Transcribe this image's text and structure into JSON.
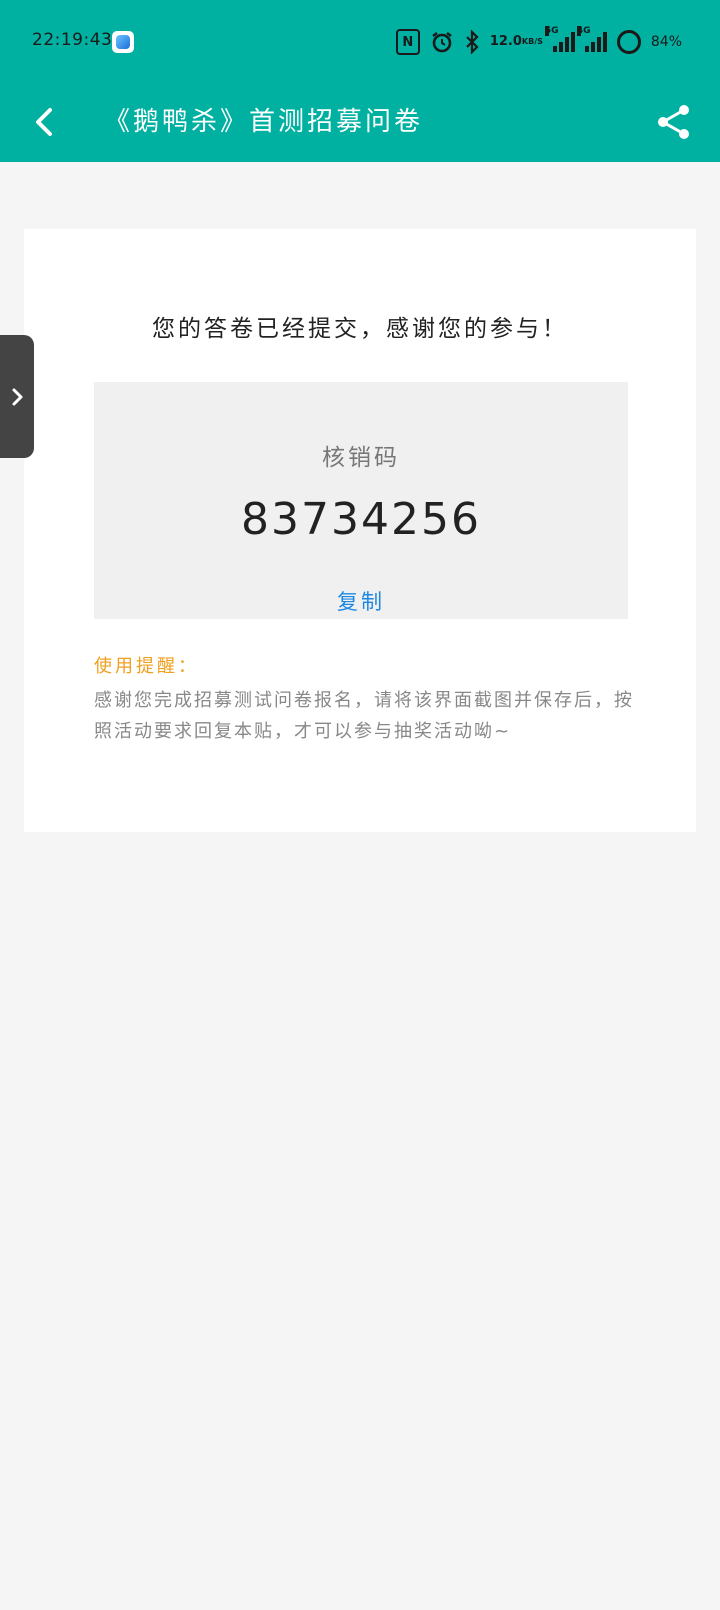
{
  "status_bar": {
    "time": "22:19:43",
    "speed_value": "12.0",
    "speed_unit": "KB/S",
    "signal_1_tag": "5G",
    "signal_2_tag": "4G",
    "battery": "84%",
    "icons": [
      "app-icon",
      "nfc-icon",
      "alarm-icon",
      "bluetooth-icon",
      "signal-5g-icon",
      "signal-4g-icon",
      "battery-icon"
    ]
  },
  "app_bar": {
    "title": "《鹅鸭杀》首测招募问卷",
    "back_icon": "chevron-left-icon",
    "share_icon": "share-icon"
  },
  "side_tab": {
    "icon": "chevron-right-icon"
  },
  "result": {
    "message": "您的答卷已经提交，感谢您的参与！",
    "code_label": "核销码",
    "code_value": "83734256",
    "copy_label": "复制",
    "reminder_title": "使用提醒：",
    "reminder_body": "感谢您完成招募测试问卷报名，请将该界面截图并保存后，按照活动要求回复本贴，才可以参与抽奖活动呦~"
  },
  "colors": {
    "accent": "#00b0a1",
    "link": "#1e88e5",
    "reminder": "#f0a020",
    "background": "#f5f5f5"
  }
}
